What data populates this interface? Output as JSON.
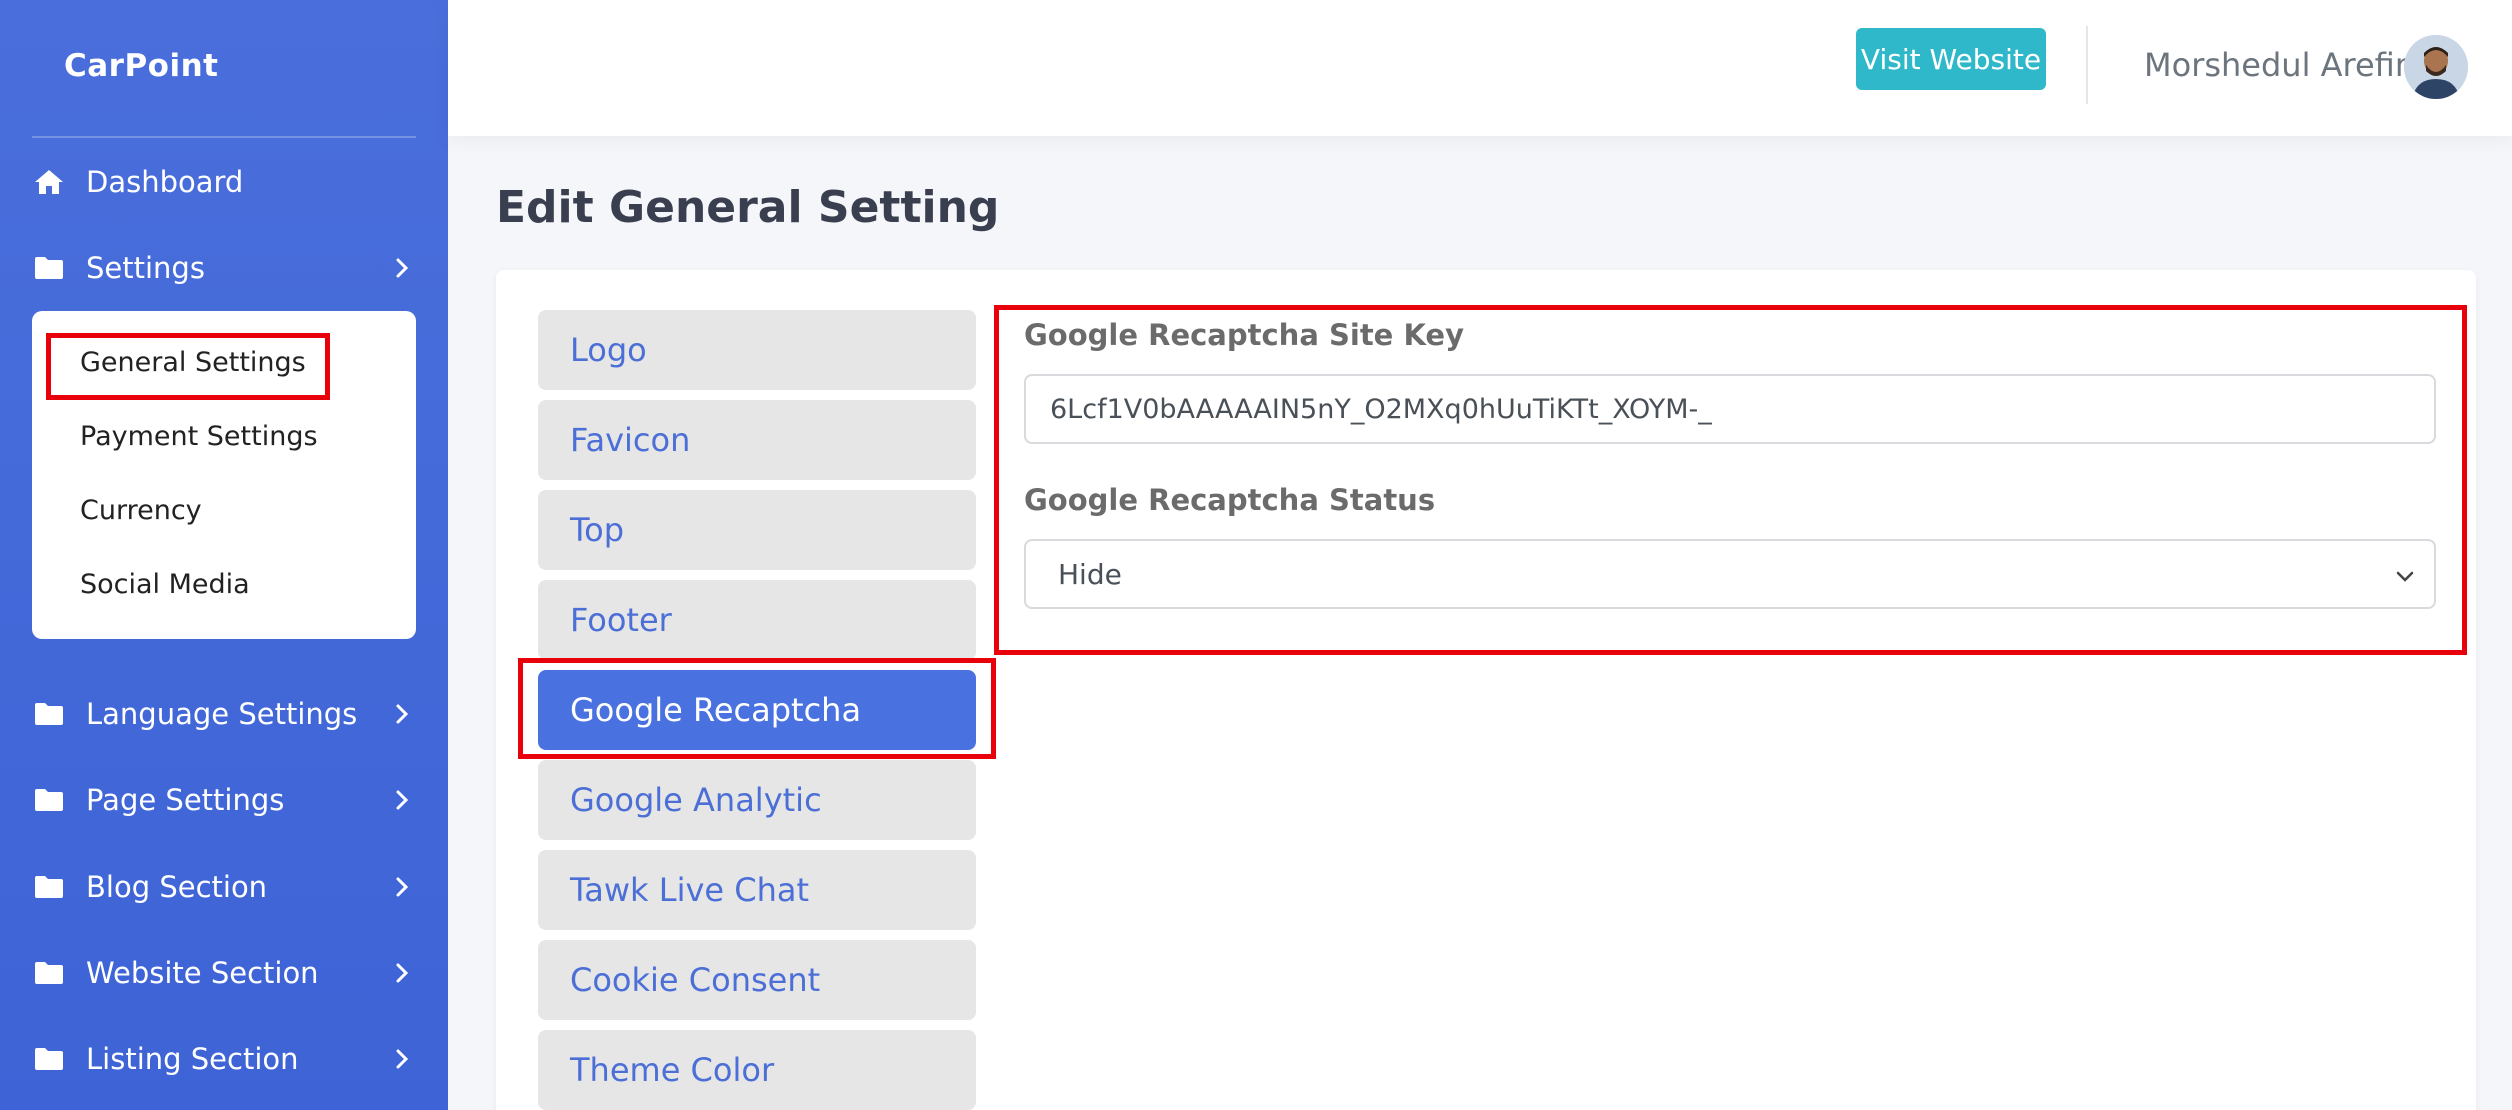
{
  "brand": "CarPoint",
  "nav": {
    "dashboard": "Dashboard",
    "settings": "Settings",
    "language_settings": "Language Settings",
    "page_settings": "Page Settings",
    "blog_section": "Blog Section",
    "website_section": "Website Section",
    "listing_section": "Listing Section"
  },
  "settings_submenu": {
    "general": "General Settings",
    "payment": "Payment Settings",
    "currency": "Currency",
    "social": "Social Media"
  },
  "header": {
    "visit_button": "Visit Website",
    "user_name": "Morshedul Arefin"
  },
  "page": {
    "title": "Edit General Setting"
  },
  "tabs": [
    {
      "label": "Logo"
    },
    {
      "label": "Favicon"
    },
    {
      "label": "Top"
    },
    {
      "label": "Footer"
    },
    {
      "label": "Google Recaptcha",
      "active": true
    },
    {
      "label": "Google Analytic"
    },
    {
      "label": "Tawk Live Chat"
    },
    {
      "label": "Cookie Consent"
    },
    {
      "label": "Theme Color"
    }
  ],
  "form": {
    "site_key_label": "Google Recaptcha Site Key",
    "site_key_value": "6Lcf1V0bAAAAAIN5nY_O2MXq0hUuTiKTt_XOYM-_",
    "status_label": "Google Recaptcha Status",
    "status_value": "Hide"
  },
  "colors": {
    "sidebar": "#4a6fdc",
    "active_tab": "#4a71e0",
    "visit_button": "#2fb8c9",
    "highlight": "#e8000b"
  }
}
